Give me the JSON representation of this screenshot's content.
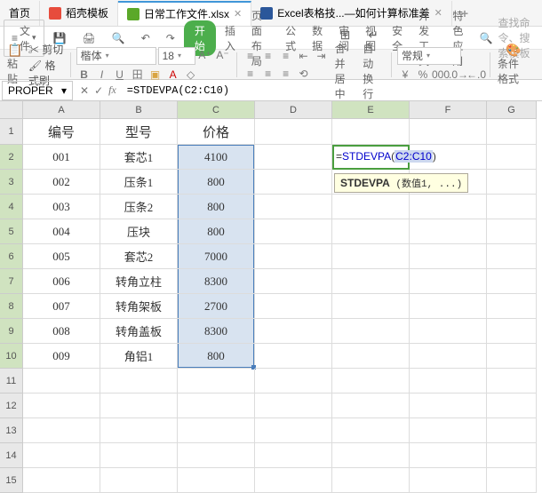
{
  "tabs": {
    "home": "首页",
    "t1": "稻壳模板",
    "t2": "日常工作文件.xlsx",
    "t3": "Excel表格技...—如何计算标准差"
  },
  "menu": {
    "file": "文件",
    "start": "开始",
    "insert": "插入",
    "layout": "页面布局",
    "formula": "公式",
    "data": "数据",
    "review": "审阅",
    "view": "视图",
    "security": "安全",
    "dev": "开发工具",
    "special": "特色应用",
    "search_placeholder": "查找命令、搜索模板"
  },
  "toolbar": {
    "paste": "粘贴",
    "cut": "剪切",
    "brush": "格式刷",
    "font_name": "楷体",
    "font_size": "18",
    "merge": "合并居中",
    "wrap": "自动换行",
    "format_general": "常规",
    "cond": "条件格式"
  },
  "formula_bar": {
    "name_box": "PROPER",
    "formula_text": "=STDEVPA(C2:C10)"
  },
  "columns": [
    "A",
    "B",
    "C",
    "D",
    "E",
    "F",
    "G"
  ],
  "headers": {
    "A": "编号",
    "B": "型号",
    "C": "价格"
  },
  "data_rows": [
    {
      "A": "001",
      "B": "套芯1",
      "C": "4100"
    },
    {
      "A": "002",
      "B": "压条1",
      "C": "800"
    },
    {
      "A": "003",
      "B": "压条2",
      "C": "800"
    },
    {
      "A": "004",
      "B": "压块",
      "C": "800"
    },
    {
      "A": "005",
      "B": "套芯2",
      "C": "7000"
    },
    {
      "A": "006",
      "B": "转角立柱",
      "C": "8300"
    },
    {
      "A": "007",
      "B": "转角架板",
      "C": "2700"
    },
    {
      "A": "008",
      "B": "转角盖板",
      "C": "8300"
    },
    {
      "A": "009",
      "B": "角铝1",
      "C": "800"
    }
  ],
  "editing": {
    "prefix": "=",
    "fn": "STDEVPA",
    "open": "(",
    "range": "C2:C10",
    "close": ")",
    "tooltip_fn": "STDEVPA",
    "tooltip_args": "(数值1, ...)"
  }
}
